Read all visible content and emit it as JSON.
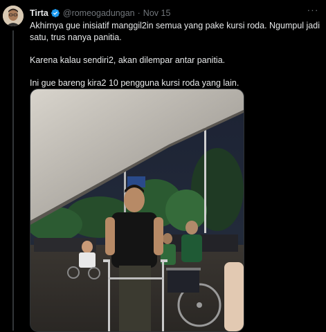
{
  "author": {
    "name": "Tirta",
    "handle": "@romeogadungan",
    "separator": "·",
    "date": "Nov 15"
  },
  "menu_label": "···",
  "tweet": {
    "paragraphs": [
      "Akhirnya gue inisiatif manggil2in semua yang pake kursi roda. Ngumpul jadi satu, trus nanya panitia.",
      "Karena kalau sendiri2, akan dilempar antar panitia.",
      "Ini gue bareng kira2 10 pengguna kursi roda yang lain."
    ]
  },
  "colors": {
    "background": "#000000",
    "text_primary": "#e7e9ea",
    "text_secondary": "#71767b",
    "verified_blue": "#1d9bf0"
  },
  "icons": {
    "verified": "verified-badge-icon",
    "more": "more-options-icon"
  }
}
